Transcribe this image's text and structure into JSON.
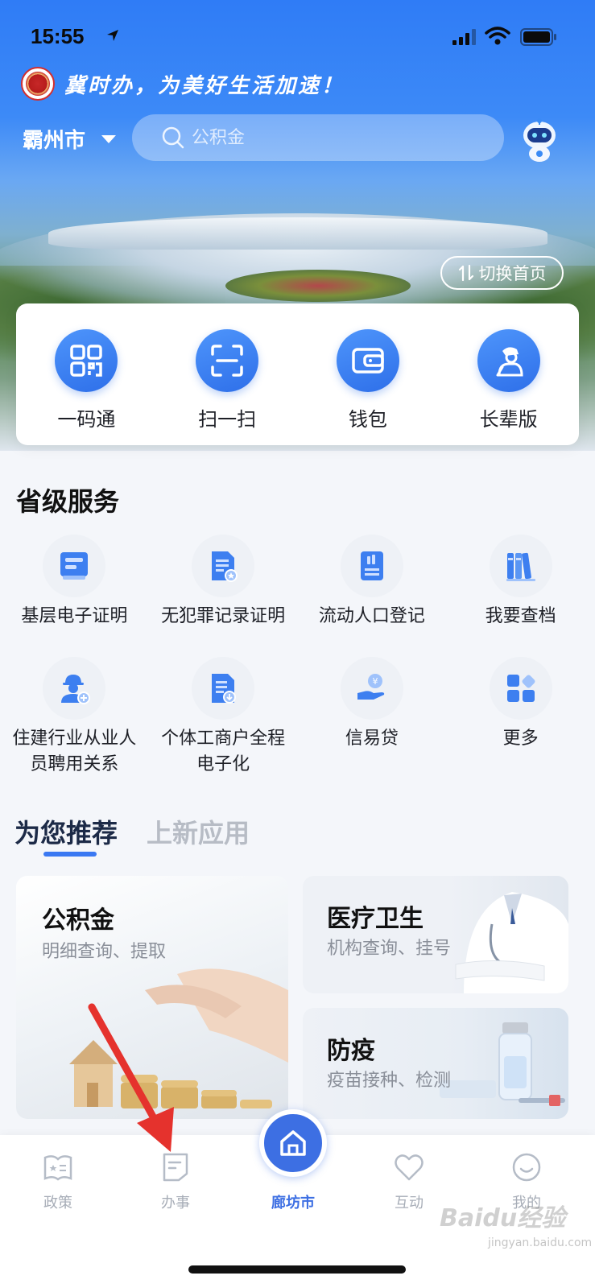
{
  "status_bar": {
    "time": "15:55"
  },
  "header": {
    "slogan": "冀时办，为美好生活加速！",
    "city": "霸州市",
    "search_placeholder": "公积金",
    "switch_home_label": "切换首页"
  },
  "quick_actions": [
    {
      "label": "一码通",
      "icon": "qr-code-icon"
    },
    {
      "label": "扫一扫",
      "icon": "scan-icon"
    },
    {
      "label": "钱包",
      "icon": "wallet-icon"
    },
    {
      "label": "长辈版",
      "icon": "elder-mode-icon"
    }
  ],
  "provincial_services": {
    "title": "省级服务",
    "items": [
      {
        "label": "基层电子证明",
        "icon": "certificate-icon"
      },
      {
        "label": "无犯罪记录证明",
        "icon": "no-crime-record-icon"
      },
      {
        "label": "流动人口登记",
        "icon": "registration-icon"
      },
      {
        "label": "我要查档",
        "icon": "archive-icon"
      },
      {
        "label": "住建行业从业人员聘用关系",
        "icon": "worker-icon"
      },
      {
        "label": "个体工商户全程电子化",
        "icon": "business-license-icon"
      },
      {
        "label": "信易贷",
        "icon": "loan-icon"
      },
      {
        "label": "更多",
        "icon": "more-apps-icon"
      }
    ]
  },
  "recommend": {
    "tabs": [
      {
        "label": "为您推荐",
        "active": true
      },
      {
        "label": "上新应用",
        "active": false
      }
    ],
    "cards": [
      {
        "title": "公积金",
        "subtitle": "明细查询、提取"
      },
      {
        "title": "医疗卫生",
        "subtitle": "机构查询、挂号"
      },
      {
        "title": "防疫",
        "subtitle": "疫苗接种、检测"
      }
    ]
  },
  "tabbar": {
    "items": [
      {
        "label": "政策",
        "icon": "policy-icon"
      },
      {
        "label": "办事",
        "icon": "affairs-icon"
      },
      {
        "label": "廊坊市",
        "icon": "home-icon",
        "active": true
      },
      {
        "label": "互动",
        "icon": "heart-icon"
      },
      {
        "label": "我的",
        "icon": "profile-icon"
      }
    ]
  },
  "watermark": {
    "text": "Baidu经验",
    "sub": "jingyan.baidu.com"
  },
  "colors": {
    "primary": "#3d6fe3",
    "accent_blue": "#2f7cf6",
    "annotation_red": "#e5322d"
  }
}
